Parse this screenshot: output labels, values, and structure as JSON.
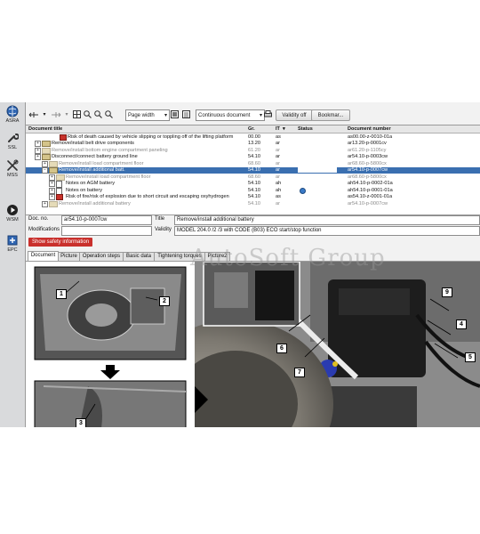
{
  "sidebar": {
    "items": [
      {
        "label": "ASRA",
        "icon": "asra-globe-icon"
      },
      {
        "label": "SSL",
        "icon": "wrench-icon"
      },
      {
        "label": "MSS",
        "icon": "tools-icon"
      },
      {
        "label": "WSM",
        "icon": "play-icon"
      },
      {
        "label": "EPC",
        "icon": "parts-icon"
      }
    ]
  },
  "toolbar": {
    "zoom_value": "Page width",
    "view_value": "Continuous document",
    "validity_label": "Validity off",
    "bookmark_label": "Bookmar..."
  },
  "tree": {
    "columns": {
      "title": "Document title",
      "gr": "Gr.",
      "it": "IT",
      "status": "Status",
      "docnum": "Document number"
    },
    "rows": [
      {
        "title": "Risk of death caused by vehicle slipping or toppling off of the lifting platform",
        "gr": "00.00",
        "it": "as",
        "doc": "as00.00-z-0010-01a"
      },
      {
        "title": "Remove/install belt drive components",
        "gr": "13.20",
        "it": "ar",
        "doc": "ar13.20-p-0001cv"
      },
      {
        "title": "Remove/install bottom engine compartment paneling",
        "gr": "61.20",
        "it": "ar",
        "doc": "ar61.20-p-1105cy"
      },
      {
        "title": "Disconnect/connect battery ground line",
        "gr": "54.10",
        "it": "ar",
        "doc": "ar54.10-p-0003cw"
      },
      {
        "title": "Remove/install load compartment floor",
        "gr": "68.60",
        "it": "ar",
        "doc": "ar68.60-p-5800cx"
      },
      {
        "title": "Remove/install additional batt.",
        "gr": "54.10",
        "it": "ar",
        "doc": "ar54.10-p-0007cw"
      },
      {
        "title": "Remove/install load compartment floor",
        "gr": "68.60",
        "it": "ar",
        "doc": "ar68.60-p-5800cx"
      },
      {
        "title": "Notes on AGM battery",
        "gr": "54.10",
        "it": "ah",
        "doc": "ah54.10-p-0002-01a"
      },
      {
        "title": "Notes on battery",
        "gr": "54.10",
        "it": "ah",
        "doc": "ah54.10-p-0001-01a"
      },
      {
        "title": "Risk of fire/risk of explosion due to short circuit and escaping oxyhydrogen",
        "gr": "54.10",
        "it": "as",
        "doc": "as54.10-z-0001-01a"
      },
      {
        "title": "Remove/install additional battery",
        "gr": "54.10",
        "it": "ar",
        "doc": "ar54.10-p-0007cw"
      }
    ]
  },
  "fields": {
    "doc_no_label": "Doc. no.",
    "doc_no_value": "ar54.10-p-0007cw",
    "title_label": "Title",
    "title_value": "Remove/install additional battery",
    "modifications_label": "Modifications",
    "validity_label": "Validity",
    "validity_value": "MODEL 204.0 /2 /3 with CODE (B03) ECO start/stop function"
  },
  "safety_button": "Show safety information",
  "tabs": [
    "Document",
    "Picture",
    "Operation steps",
    "Basic data",
    "Tightening torques",
    "Picture2"
  ],
  "figure": {
    "callouts": [
      "1",
      "2",
      "3",
      "4",
      "5",
      "6",
      "7",
      "9"
    ],
    "watermark": "AutoSoft Group"
  },
  "colors": {
    "selection": "#3a6fb0",
    "safety": "#c9302c",
    "sidebar": "#d9dadc"
  }
}
